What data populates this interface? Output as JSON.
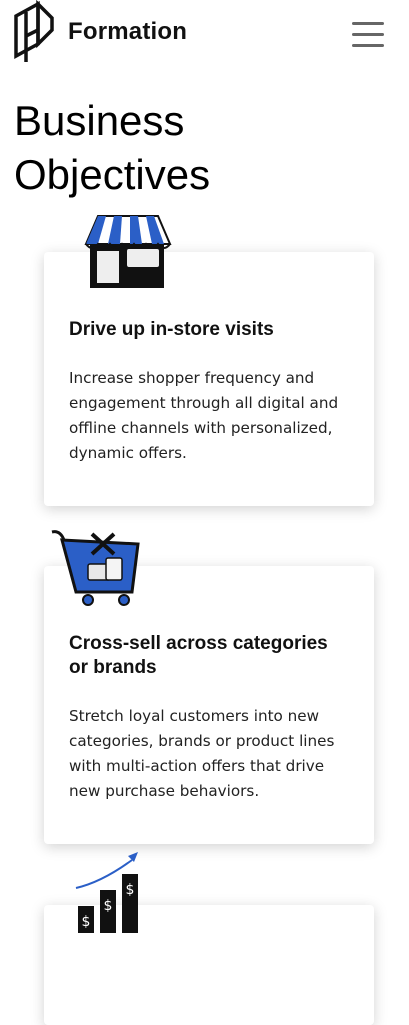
{
  "header": {
    "brand": "Formation",
    "logo_icon": "formation-logo-icon",
    "menu_icon": "hamburger-menu-icon"
  },
  "page": {
    "title_line1": "Business",
    "title_line2": "Objectives"
  },
  "cards": [
    {
      "icon": "storefront-icon",
      "title": "Drive up in-store visits",
      "text": "Increase shopper frequency and engagement through all digital and offline channels with personalized, dynamic offers."
    },
    {
      "icon": "shopping-cart-icon",
      "title_line1": "Cross-sell across categories",
      "title_line2": "or brands",
      "text": "Stretch loyal customers into new categories, brands or product lines with multi-action offers that drive new purchase behaviors."
    },
    {
      "icon": "growth-chart-icon"
    }
  ],
  "colors": {
    "accent_blue": "#2b5fc7",
    "text_dark": "#111111"
  }
}
